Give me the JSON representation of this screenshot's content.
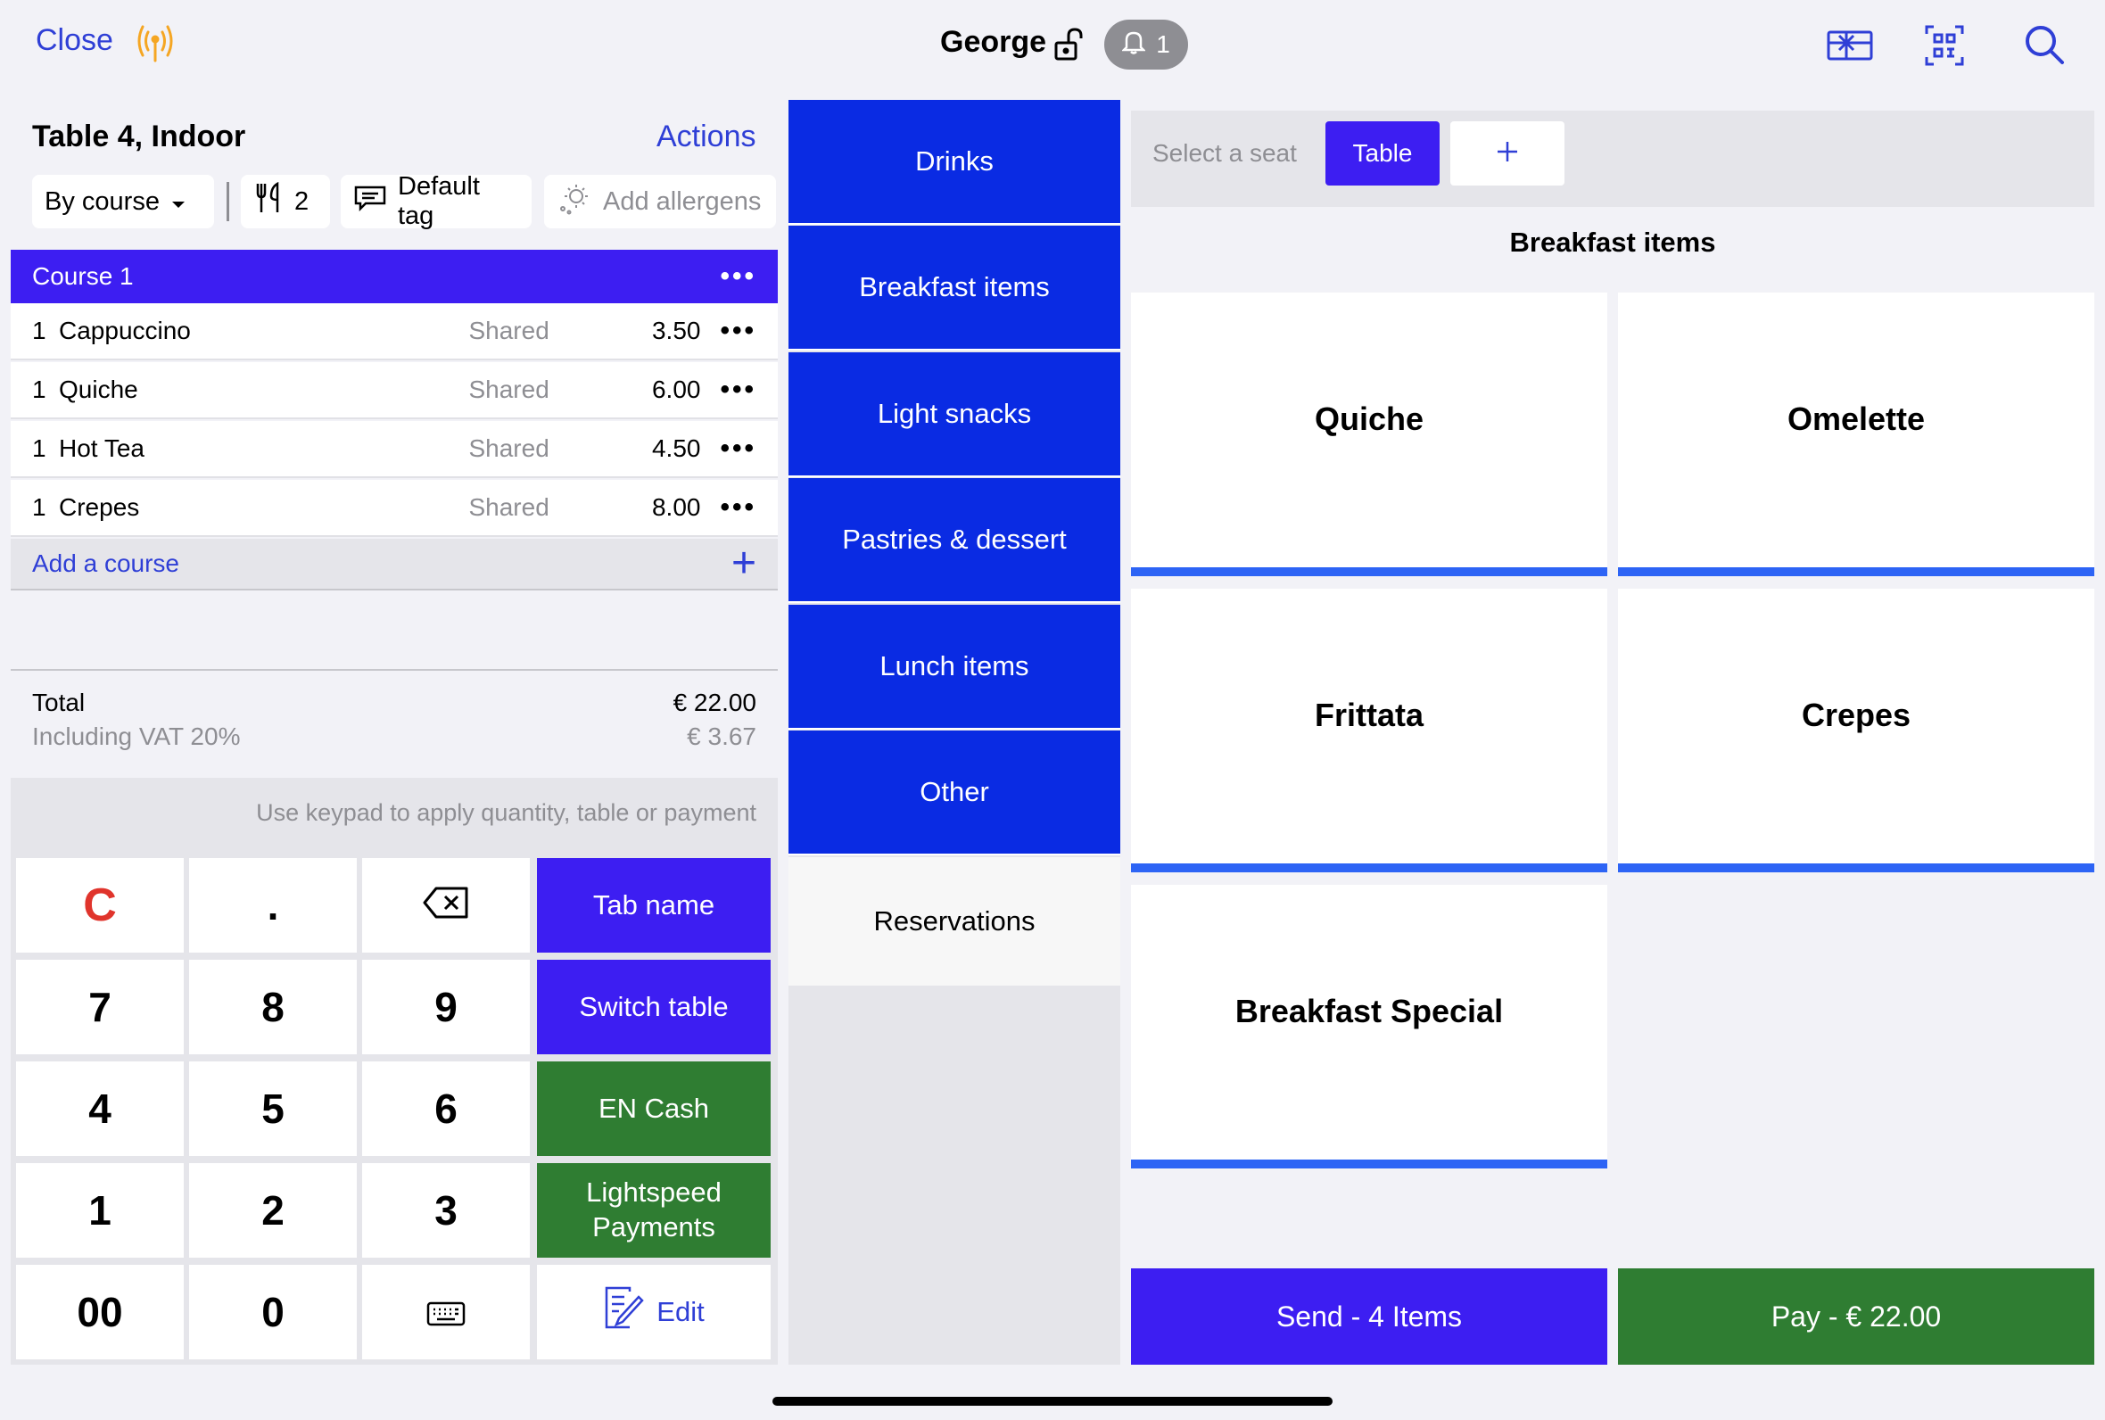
{
  "topbar": {
    "close_label": "Close",
    "user_name": "George",
    "notification_count": "1",
    "accent_color": "#2f3fd6",
    "icons": [
      "signal-icon",
      "lock-open-icon",
      "bell-icon",
      "gift-card-icon",
      "qr-scan-icon",
      "search-icon"
    ]
  },
  "order": {
    "title": "Table 4, Indoor",
    "actions_label": "Actions",
    "chips": {
      "course_mode": "By course",
      "covers": "2",
      "tag": "Default tag",
      "allergens": "Add allergens"
    },
    "course": {
      "name": "Course 1",
      "items": [
        {
          "qty": "1",
          "name": "Cappuccino",
          "seat": "Shared",
          "price": "3.50"
        },
        {
          "qty": "1",
          "name": "Quiche",
          "seat": "Shared",
          "price": "6.00"
        },
        {
          "qty": "1",
          "name": "Hot Tea",
          "seat": "Shared",
          "price": "4.50"
        },
        {
          "qty": "1",
          "name": "Crepes",
          "seat": "Shared",
          "price": "8.00"
        }
      ]
    },
    "add_course_label": "Add a course",
    "total_label": "Total",
    "total_value": "€ 22.00",
    "vat_label": "Including VAT 20%",
    "vat_value": "€ 3.67"
  },
  "keypad": {
    "hint": "Use keypad to apply quantity, table or payment",
    "keys": {
      "clear": "C",
      "dot": ".",
      "k7": "7",
      "k8": "8",
      "k9": "9",
      "k4": "4",
      "k5": "5",
      "k6": "6",
      "k1": "1",
      "k2": "2",
      "k3": "3",
      "k00": "00",
      "k0": "0"
    },
    "side": {
      "tab_name": "Tab name",
      "switch_table": "Switch table",
      "cash": "EN Cash",
      "lightspeed": "Lightspeed Payments",
      "edit": "Edit"
    }
  },
  "categories": [
    {
      "label": "Drinks"
    },
    {
      "label": "Breakfast items"
    },
    {
      "label": "Light snacks"
    },
    {
      "label": "Pastries & dessert"
    },
    {
      "label": "Lunch items"
    },
    {
      "label": "Other"
    },
    {
      "label": "Reservations"
    }
  ],
  "seat_bar": {
    "label": "Select a seat",
    "table_label": "Table"
  },
  "products": {
    "section_title": "Breakfast items",
    "items": [
      {
        "name": "Quiche"
      },
      {
        "name": "Omelette"
      },
      {
        "name": "Frittata"
      },
      {
        "name": "Crepes"
      },
      {
        "name": "Breakfast Special"
      }
    ]
  },
  "footer": {
    "send_label": "Send - 4 Items",
    "pay_label": "Pay - € 22.00"
  },
  "colors": {
    "primary_blue": "#3d1ef2",
    "category_blue": "#0a2be3",
    "green": "#2f7d32",
    "product_underline": "#2d64f5",
    "clear_red": "#e0342c"
  }
}
